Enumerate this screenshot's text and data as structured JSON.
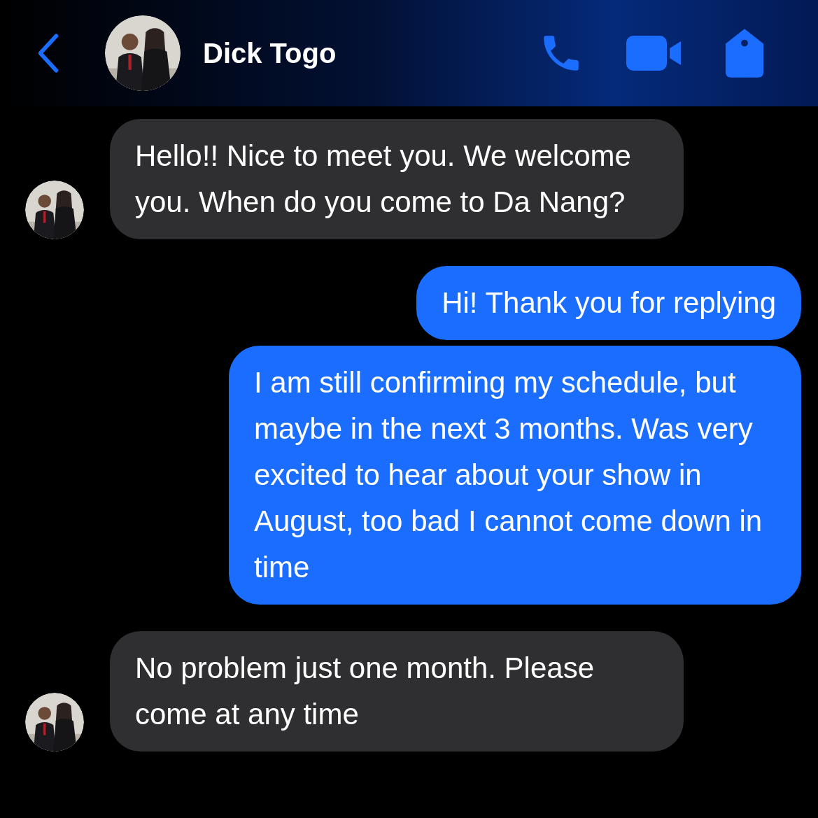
{
  "header": {
    "contact_name": "Dick Togo"
  },
  "messages": [
    {
      "kind": "incoming",
      "text": "Hello!! Nice to meet you. We welcome you. When do you come to Da Nang?"
    },
    {
      "kind": "outgoing",
      "text": "Hi! Thank you for replying"
    },
    {
      "kind": "outgoing",
      "text": "I am still confirming my schedule, but maybe in the next 3 months. Was very excited to hear about your show in August, too bad I cannot come down in time"
    },
    {
      "kind": "incoming",
      "text": "No problem just one month. Please come at any time"
    }
  ]
}
